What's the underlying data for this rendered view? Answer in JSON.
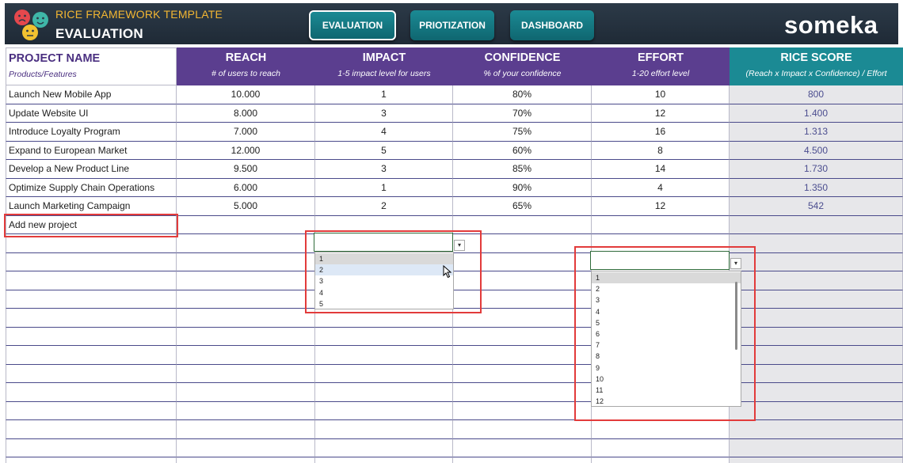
{
  "header": {
    "app_title": "RICE FRAMEWORK TEMPLATE",
    "page_title": "EVALUATION",
    "brand": "someka",
    "nav": [
      {
        "label": "EVALUATION",
        "active": true
      },
      {
        "label": "PRIOTIZATION",
        "active": false
      },
      {
        "label": "DASHBOARD",
        "active": false
      }
    ]
  },
  "table": {
    "columns": [
      {
        "title": "PROJECT NAME",
        "subtitle": "Products/Features"
      },
      {
        "title": "REACH",
        "subtitle": "# of users to reach"
      },
      {
        "title": "IMPACT",
        "subtitle": "1-5 impact level for users"
      },
      {
        "title": "CONFIDENCE",
        "subtitle": "% of your confidence"
      },
      {
        "title": "EFFORT",
        "subtitle": "1-20 effort level"
      },
      {
        "title": "RICE SCORE",
        "subtitle": "(Reach x Impact x Confidence) / Effort"
      }
    ],
    "rows": [
      {
        "name": "Launch New Mobile App",
        "reach": "10.000",
        "impact": "1",
        "confidence": "80%",
        "effort": "10",
        "score": "800"
      },
      {
        "name": "Update Website UI",
        "reach": "8.000",
        "impact": "3",
        "confidence": "70%",
        "effort": "12",
        "score": "1.400"
      },
      {
        "name": "Introduce Loyalty Program",
        "reach": "7.000",
        "impact": "4",
        "confidence": "75%",
        "effort": "16",
        "score": "1.313"
      },
      {
        "name": "Expand to European Market",
        "reach": "12.000",
        "impact": "5",
        "confidence": "60%",
        "effort": "8",
        "score": "4.500"
      },
      {
        "name": "Develop a New Product Line",
        "reach": "9.500",
        "impact": "3",
        "confidence": "85%",
        "effort": "14",
        "score": "1.730"
      },
      {
        "name": "Optimize Supply Chain Operations",
        "reach": "6.000",
        "impact": "1",
        "confidence": "90%",
        "effort": "4",
        "score": "1.350"
      },
      {
        "name": "Launch Marketing Campaign",
        "reach": "5.000",
        "impact": "2",
        "confidence": "65%",
        "effort": "12",
        "score": "542"
      }
    ],
    "add_new_label": "Add new project"
  },
  "impact_dropdown": {
    "options": [
      "1",
      "2",
      "3",
      "4",
      "5"
    ],
    "selected": "1",
    "hovered": "2"
  },
  "effort_dropdown": {
    "options": [
      "1",
      "2",
      "3",
      "4",
      "5",
      "6",
      "7",
      "8",
      "9",
      "10",
      "11",
      "12"
    ],
    "selected": "1"
  },
  "colors": {
    "header_bg": "#1f2a36",
    "title_accent": "#f2b632",
    "column_header": "#5b3e8f",
    "rice_header": "#1b8a94",
    "nav_button": "#1b8a94",
    "score_bg": "#e7e7ea",
    "highlight": "#e23b3b"
  }
}
